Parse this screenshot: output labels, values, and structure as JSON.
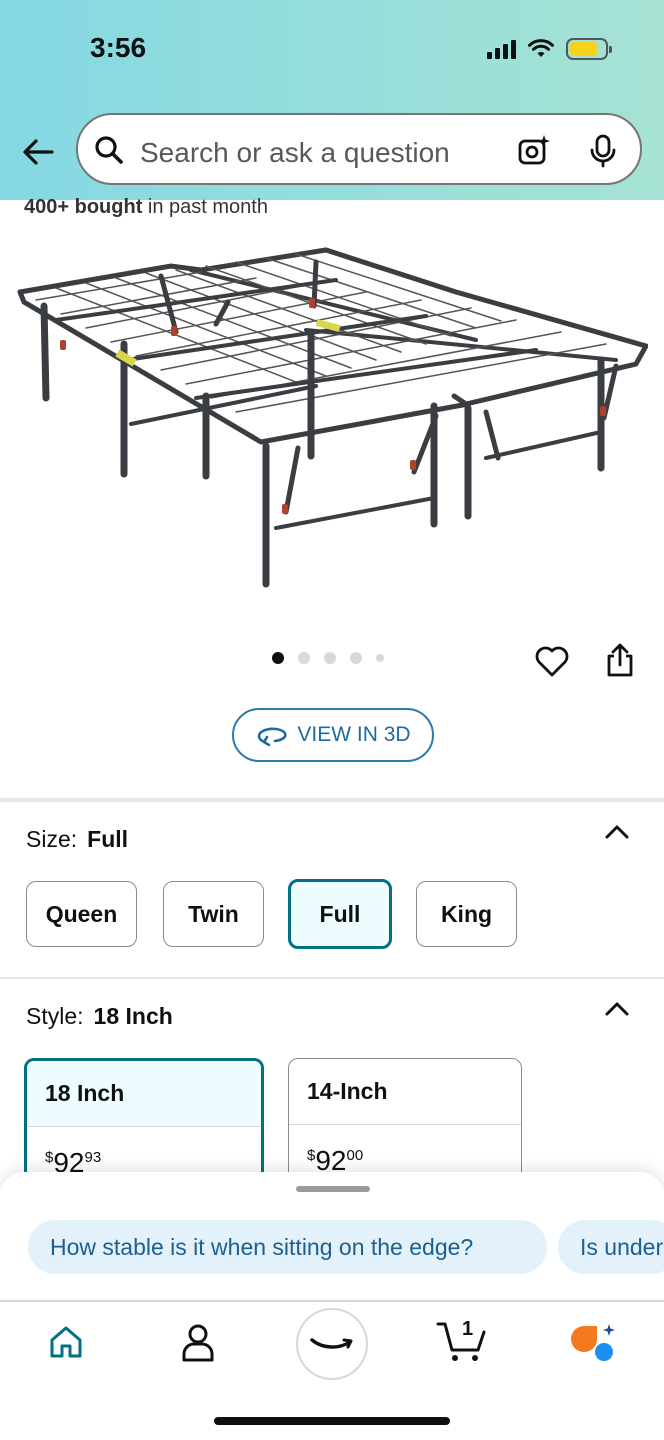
{
  "status_bar": {
    "time": "3:56"
  },
  "search": {
    "placeholder": "Search or ask a question"
  },
  "product": {
    "bought_bold": "400+ bought",
    "bought_rest": " in past month",
    "image_count": 5,
    "active_image": 1,
    "view_3d_label": "VIEW IN 3D"
  },
  "size": {
    "label": "Size:",
    "selected": "Full",
    "options": [
      "Queen",
      "Twin",
      "Full",
      "King"
    ]
  },
  "style": {
    "label": "Style:",
    "selected": "18 Inch",
    "cards": [
      {
        "name": "18 Inch",
        "currency": "$",
        "price_whole": "92",
        "price_fraction": "93"
      },
      {
        "name": "14-Inch",
        "currency": "$",
        "price_whole": "92",
        "price_fraction": "00"
      }
    ]
  },
  "suggestions": [
    "How stable is it when sitting on the edge?",
    "Is under"
  ],
  "nav": {
    "cart_count": "1"
  },
  "colors": {
    "accent": "#007185",
    "link": "#1e6ba0",
    "chip_bg": "#e3f1fb",
    "header_start": "#84d8e3",
    "header_end": "#a6e3d4"
  }
}
